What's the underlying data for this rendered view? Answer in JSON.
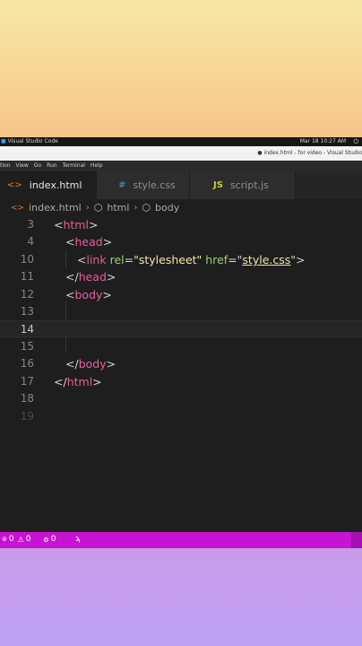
{
  "os_bar": {
    "app_name": "Visual Studio Code",
    "datetime": "Mar 18  10:27 AM"
  },
  "title_bar": {
    "window_title": "● index.html - for video - Visual Studio"
  },
  "menu": [
    "tion",
    "View",
    "Go",
    "Run",
    "Terminal",
    "Help"
  ],
  "tabs": [
    {
      "icon": "html-file-icon",
      "label": "index.html",
      "modified": true
    },
    {
      "icon": "css-file-icon",
      "icon_text": "#",
      "label": "style.css"
    },
    {
      "icon": "js-file-icon",
      "icon_text": "JS",
      "label": "script.js"
    }
  ],
  "breadcrumb": [
    "index.html",
    "html",
    "body"
  ],
  "editor": {
    "lines": [
      {
        "num": "3",
        "text": "<html>"
      },
      {
        "num": "4",
        "text": "<head>"
      },
      {
        "num": "10",
        "text": "<link rel=\"stylesheet\" href=\"style.css\">"
      },
      {
        "num": "11",
        "text": "</head>"
      },
      {
        "num": "12",
        "text": "<body>"
      },
      {
        "num": "13",
        "text": ""
      },
      {
        "num": "14",
        "text": ""
      },
      {
        "num": "15",
        "text": ""
      },
      {
        "num": "16",
        "text": "</body>"
      },
      {
        "num": "17",
        "text": "</html>"
      },
      {
        "num": "18",
        "text": ""
      },
      {
        "num": "19",
        "text": ""
      }
    ],
    "link_parts": {
      "tag": "link",
      "attr1": "rel",
      "val1": "\"stylesheet\"",
      "attr2": "href",
      "val2": "style.css"
    },
    "current_line": "14"
  },
  "status_bar": {
    "errors": "0",
    "warnings": "0",
    "ports": "0"
  },
  "colors": {
    "status_bar": "#c713d4",
    "tag": "#e85d9c",
    "attribute": "#95d46b",
    "string": "#f0e6a6"
  }
}
